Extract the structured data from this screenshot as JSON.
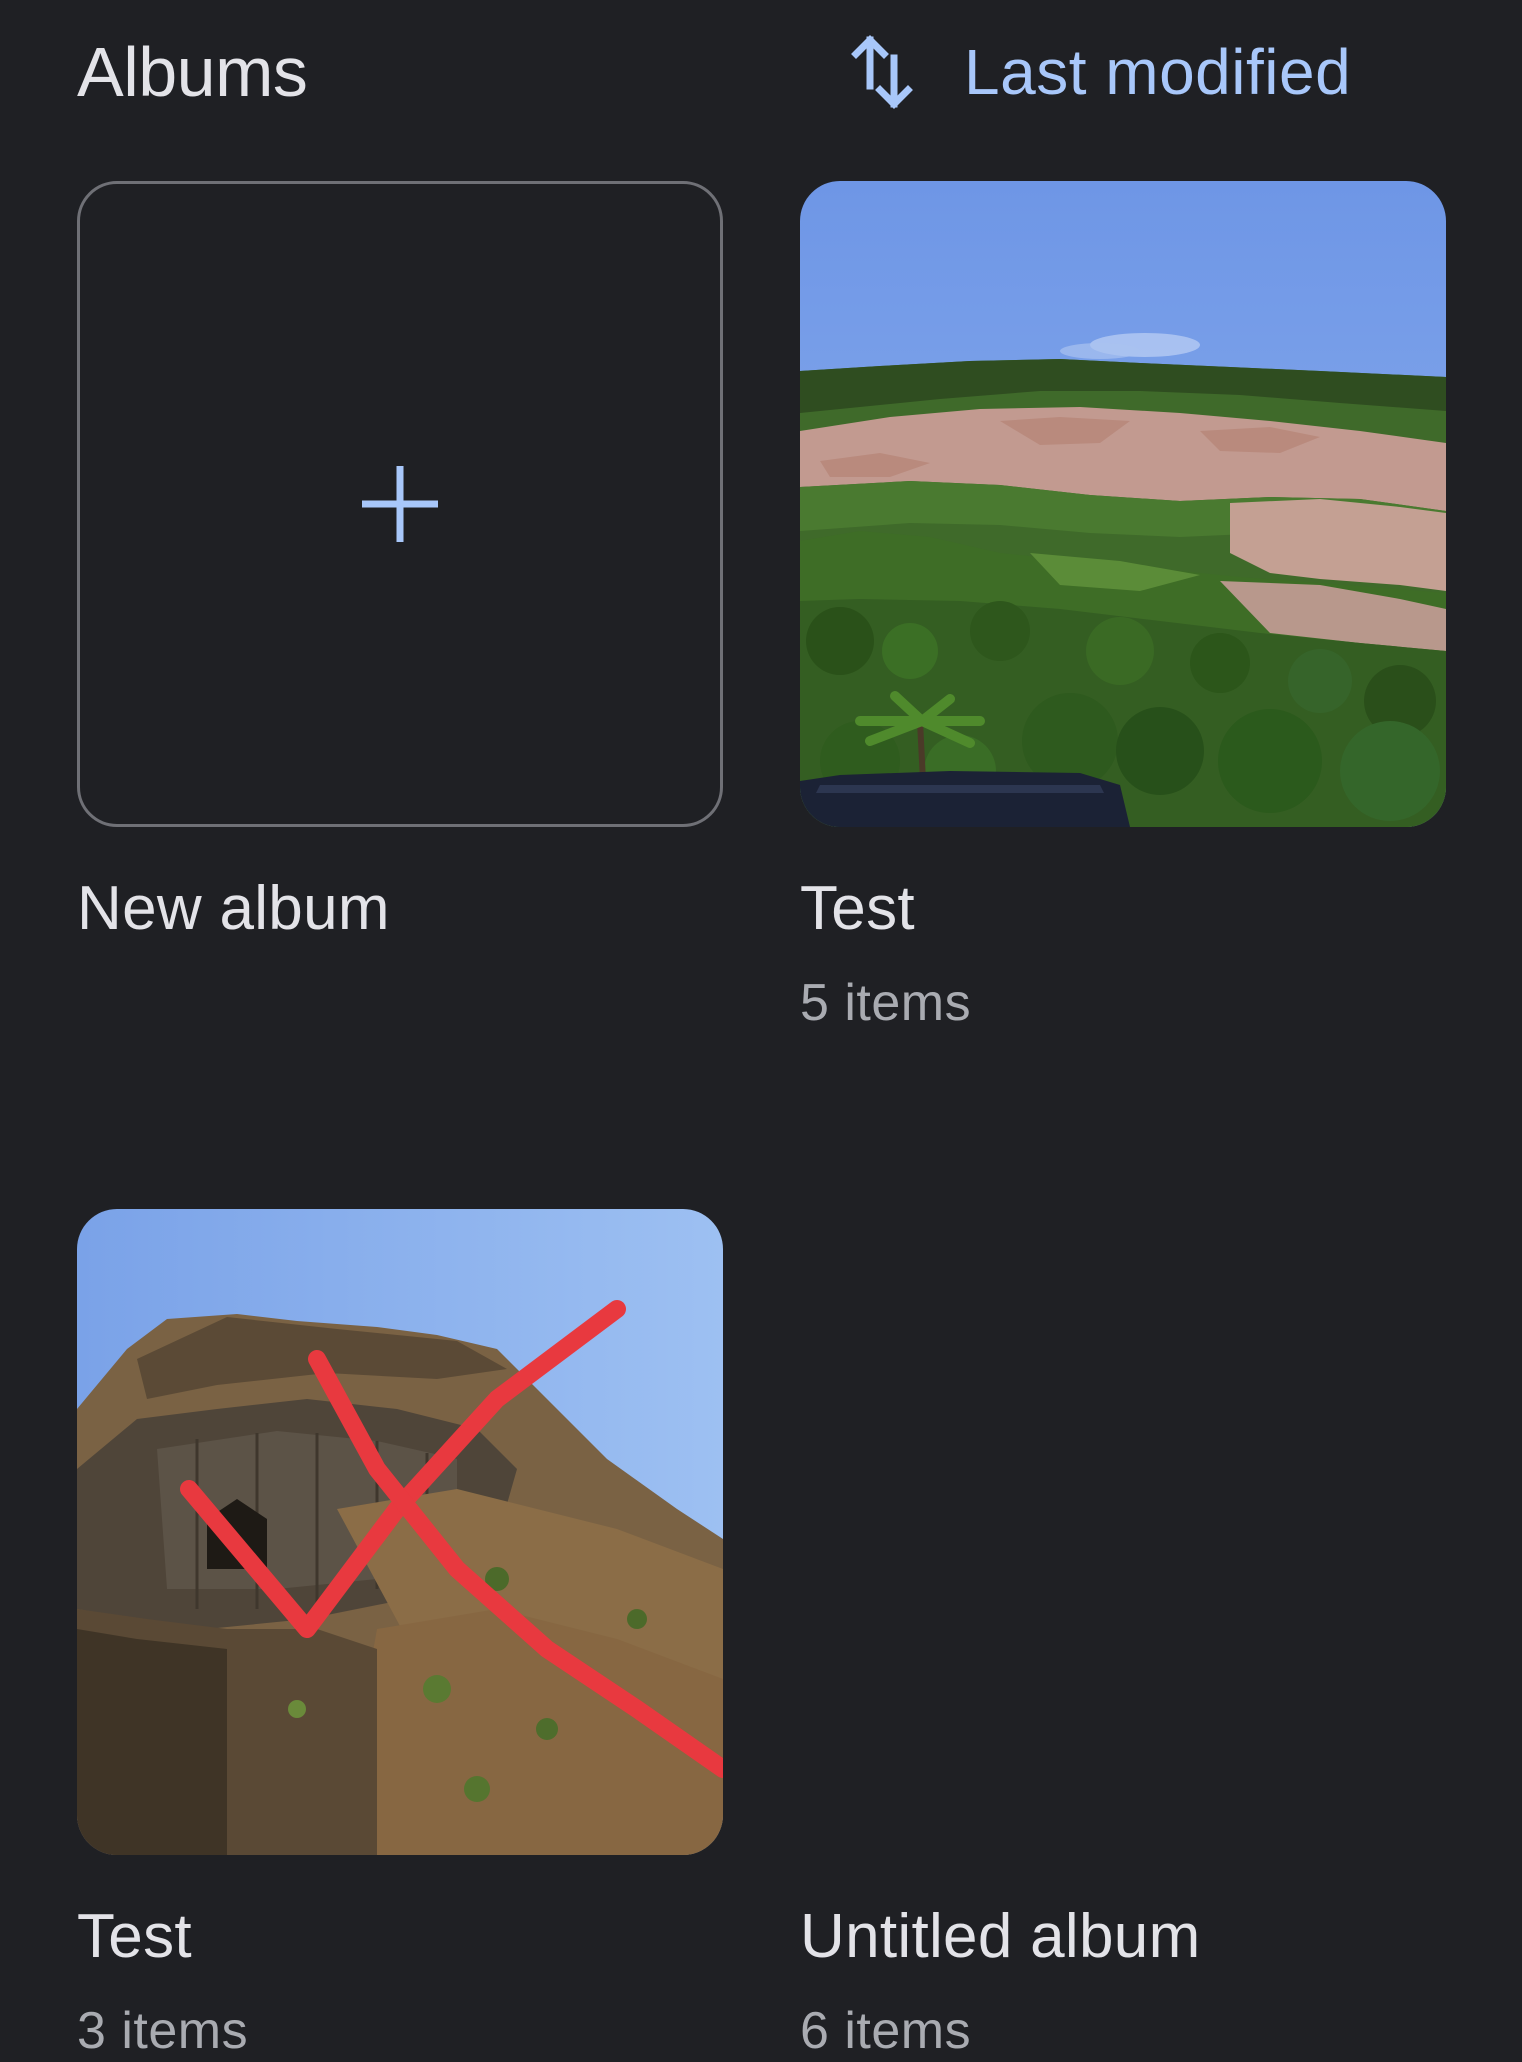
{
  "header": {
    "title": "Albums",
    "sort_label": "Last modified",
    "sort_icon": "swap-vert-icon"
  },
  "colors": {
    "background": "#1f2024",
    "accent": "#a8c7fa",
    "primary_text": "#e3e3e8",
    "secondary_text": "#a9abb1"
  },
  "albums": [
    {
      "name": "New album",
      "icon": "plus-icon"
    },
    {
      "name": "Test",
      "count": "5 items"
    },
    {
      "name": "Test",
      "count": "3 items"
    },
    {
      "name": "Untitled album",
      "count": "6 items"
    }
  ]
}
